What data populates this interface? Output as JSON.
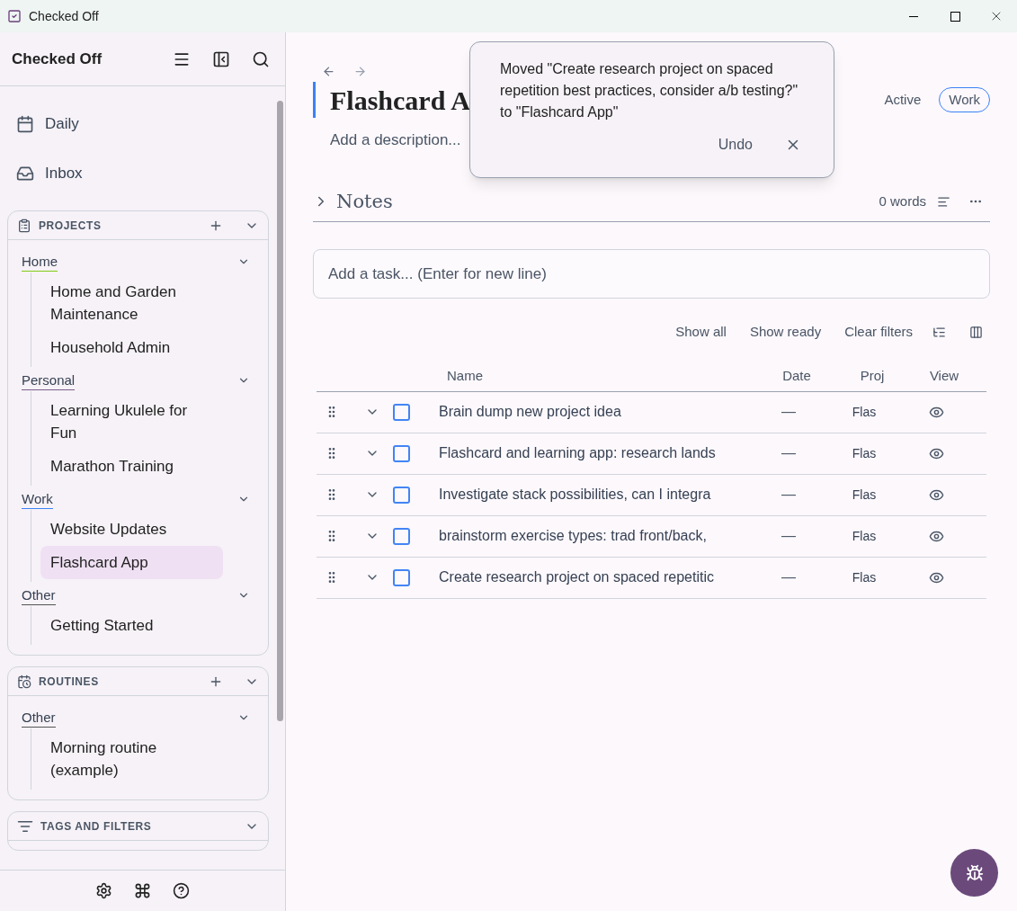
{
  "window": {
    "title": "Checked Off"
  },
  "sidebar": {
    "app_name": "Checked Off",
    "nav": [
      {
        "label": "Daily",
        "kind": "calendar"
      },
      {
        "label": "Inbox",
        "kind": "inbox"
      }
    ],
    "sections": [
      {
        "title": "PROJECTS",
        "kind": "projects",
        "addable": true,
        "groups": [
          {
            "label": "Home",
            "color": "#84cc16",
            "children": [
              {
                "label": "Home and Garden Maintenance",
                "selected": false
              },
              {
                "label": "Household Admin",
                "selected": false
              }
            ]
          },
          {
            "label": "Personal",
            "color": "#7c5c8a",
            "children": [
              {
                "label": "Learning Ukulele for Fun",
                "selected": false
              },
              {
                "label": "Marathon Training",
                "selected": false
              }
            ]
          },
          {
            "label": "Work",
            "color": "#3b82f6",
            "children": [
              {
                "label": "Website Updates",
                "selected": false
              },
              {
                "label": "Flashcard App",
                "selected": true
              }
            ]
          },
          {
            "label": "Other",
            "color": "#555555",
            "children": [
              {
                "label": "Getting Started",
                "selected": false
              }
            ]
          }
        ]
      },
      {
        "title": "ROUTINES",
        "kind": "routines",
        "addable": true,
        "groups": [
          {
            "label": "Other",
            "color": "#555555",
            "children": [
              {
                "label": "Morning routine (example)",
                "selected": false
              }
            ]
          }
        ]
      },
      {
        "title": "TAGS AND FILTERS",
        "kind": "filters",
        "addable": false
      }
    ]
  },
  "project": {
    "title": "Flashcard A",
    "description_placeholder": "Add a description...",
    "status": "Active",
    "tag": "Work"
  },
  "notes": {
    "title": "Notes",
    "word_count": "0 words"
  },
  "task_input": {
    "placeholder": "Add a task... (Enter for new line)"
  },
  "filters": [
    "Show all",
    "Show ready",
    "Clear filters"
  ],
  "table": {
    "columns": [
      "Name",
      "Date",
      "Proj",
      "View"
    ],
    "rows": [
      {
        "name": "Brain dump new project idea",
        "date": "—",
        "proj": "Flas",
        "checked": false
      },
      {
        "name": "Flashcard and learning app: research lands",
        "date": "—",
        "proj": "Flas",
        "checked": false
      },
      {
        "name": "Investigate stack possibilities, can I integra",
        "date": "—",
        "proj": "Flas",
        "checked": false
      },
      {
        "name": "brainstorm exercise types: trad front/back,",
        "date": "—",
        "proj": "Flas",
        "checked": false
      },
      {
        "name": "Create research project on spaced repetitic",
        "date": "—",
        "proj": "Flas",
        "checked": false
      }
    ]
  },
  "toast": {
    "message": "Moved \"Create research project on spaced repetition best practices, consider a/b testing?\" to \"Flashcard App\"",
    "action": "Undo"
  }
}
